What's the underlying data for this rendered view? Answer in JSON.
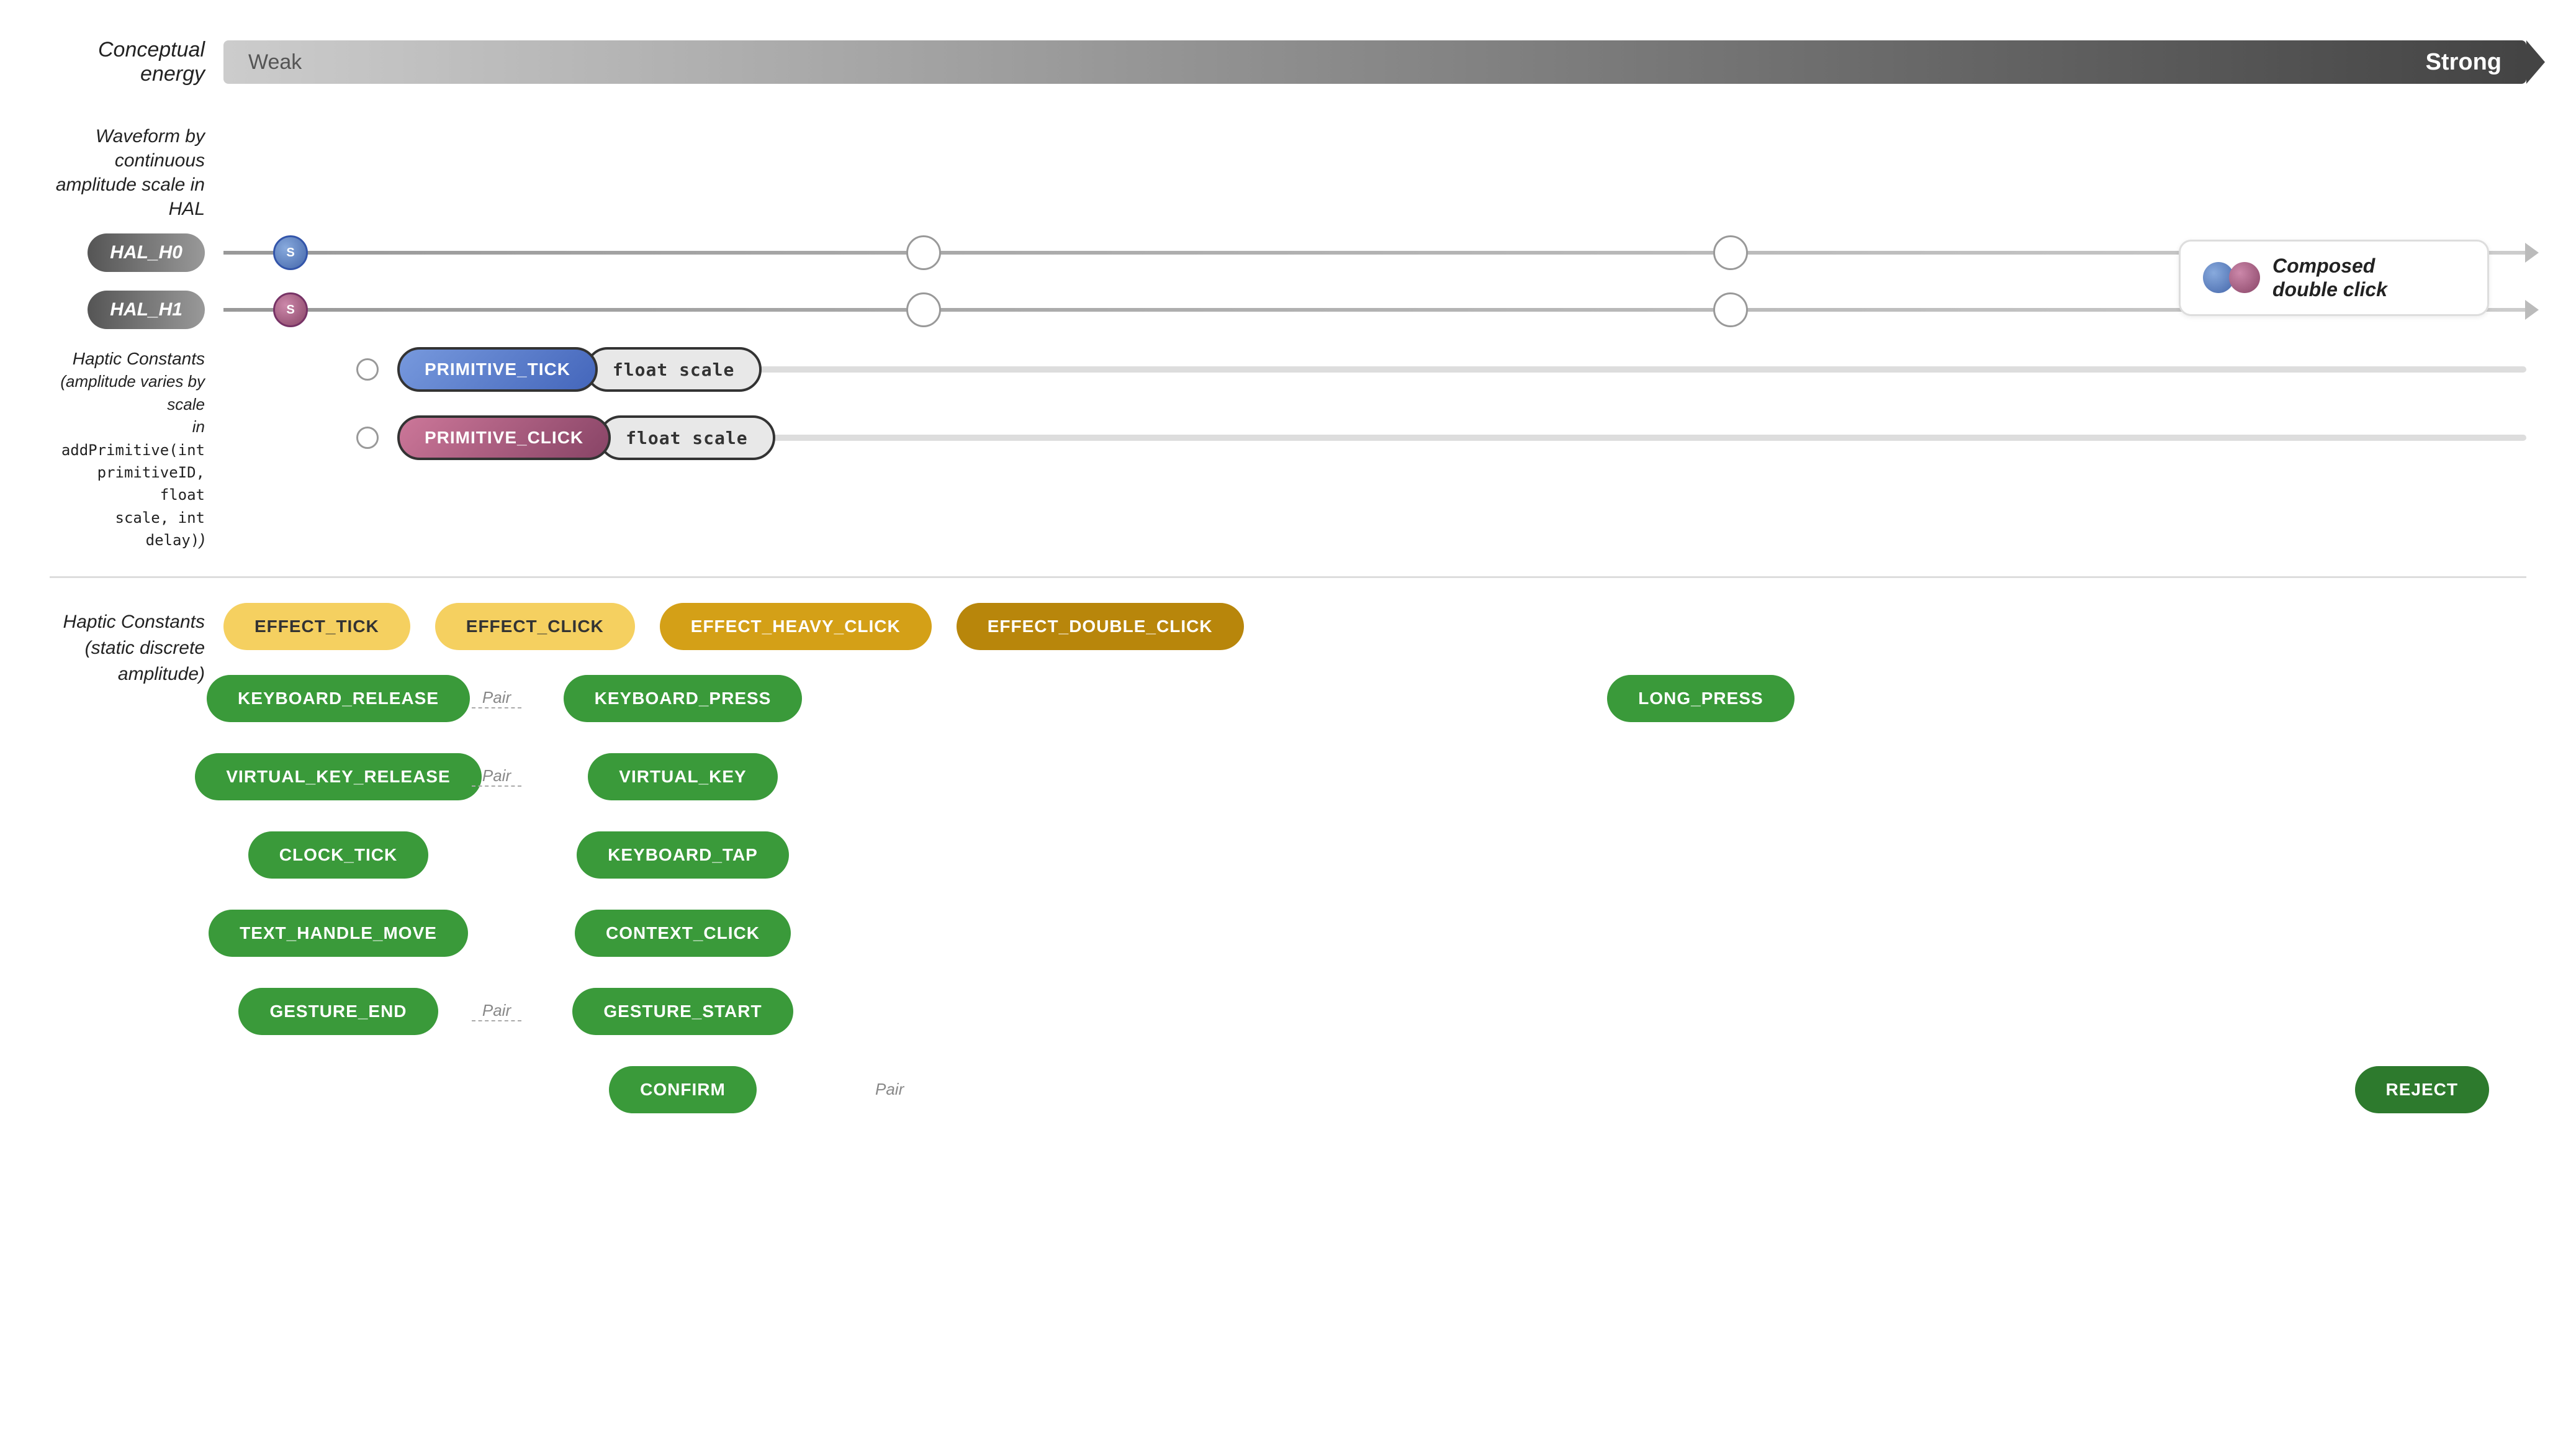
{
  "header": {
    "energy_label": "Conceptual energy",
    "energy_weak": "Weak",
    "energy_strong": "Strong"
  },
  "waveform": {
    "label": "Waveform by continuous\namplitude scale in HAL",
    "hal_h0": "HAL_H0",
    "hal_h1": "HAL_H1",
    "s_label": "S",
    "composed_legend_text": "Composed\ndouble click"
  },
  "haptic_constants_label": "Haptic Constants\n(amplitude varies by scale\nin addPrimitive(int\nprimitiveID, float\nscale, int delay))",
  "primitive_tick": "PRIMITIVE_TICK",
  "primitive_click": "PRIMITIVE_CLICK",
  "float_scale": "float scale",
  "bottom": {
    "section_label": "Haptic Constants\n(static discrete\namplitude)",
    "effects": {
      "effect_tick": "EFFECT_TICK",
      "effect_click": "EFFECT_CLICK",
      "effect_heavy_click": "EFFECT_HEAVY_CLICK",
      "effect_double_click": "EFFECT_DOUBLE_CLICK"
    },
    "constants": {
      "keyboard_release": "KEYBOARD_RELEASE",
      "keyboard_press": "KEYBOARD_PRESS",
      "long_press": "LONG_PRESS",
      "virtual_key_release": "VIRTUAL_KEY_RELEASE",
      "virtual_key": "VIRTUAL_KEY",
      "clock_tick": "CLOCK_TICK",
      "keyboard_tap": "KEYBOARD_TAP",
      "text_handle_move": "TEXT_HANDLE_MOVE",
      "context_click": "CONTEXT_CLICK",
      "gesture_end": "GESTURE_END",
      "gesture_start": "GESTURE_START",
      "confirm": "CONFIRM",
      "reject": "REJECT",
      "pair_label": "Pair"
    }
  }
}
